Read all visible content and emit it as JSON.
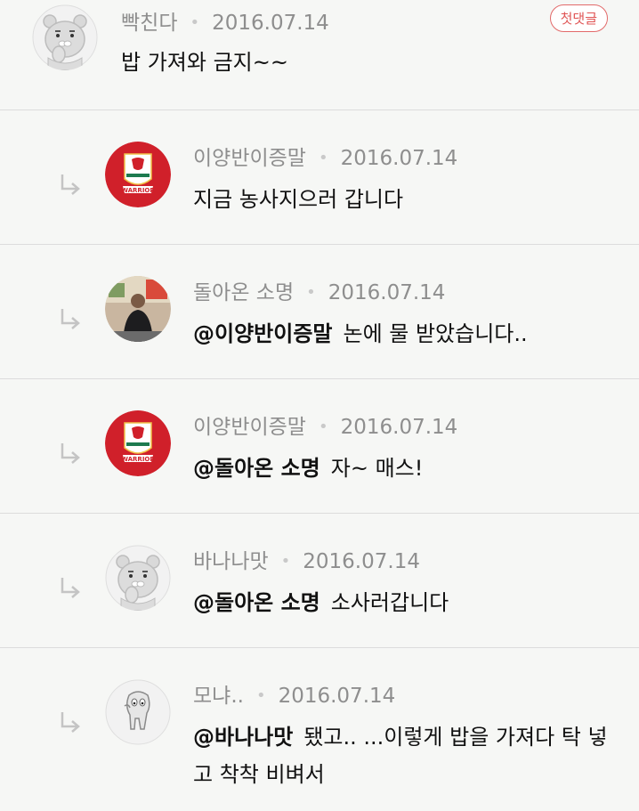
{
  "comments": [
    {
      "author": "빡친다",
      "date": "2016.07.14",
      "badge": "첫댓글",
      "text": "밥 가져와 금지~~",
      "avatar_icon": "ryan-bear-icon"
    },
    {
      "author": "이양반이증말",
      "date": "2016.07.14",
      "mention": "",
      "text": "지금 농사지으러 갑니다",
      "avatar_icon": "liverpool-crest-icon"
    },
    {
      "author": "돌아온 소명",
      "date": "2016.07.14",
      "mention": "@이양반이증말",
      "text": "논에 물 받았습니다..",
      "avatar_icon": "person-photo"
    },
    {
      "author": "이양반이증말",
      "date": "2016.07.14",
      "mention": "@돌아온 소명",
      "text": "자~ 매스!",
      "avatar_icon": "liverpool-crest-icon"
    },
    {
      "author": "바나나맛",
      "date": "2016.07.14",
      "mention": "@돌아온 소명",
      "text": "소사러갑니다",
      "avatar_icon": "ryan-bear-icon"
    },
    {
      "author": "모냐..",
      "date": "2016.07.14",
      "mention": "@바나나맛",
      "text": "됐고.. ...이렇게 밥을 가져다 탁 넣고 착착 비벼서",
      "avatar_icon": "muzi-character-icon"
    }
  ],
  "colors": {
    "background": "#f6f7f5",
    "divider": "#dcdcdc",
    "meta_text": "#8e8e8e",
    "badge": "#e05555",
    "crest_red": "#d0202a"
  }
}
